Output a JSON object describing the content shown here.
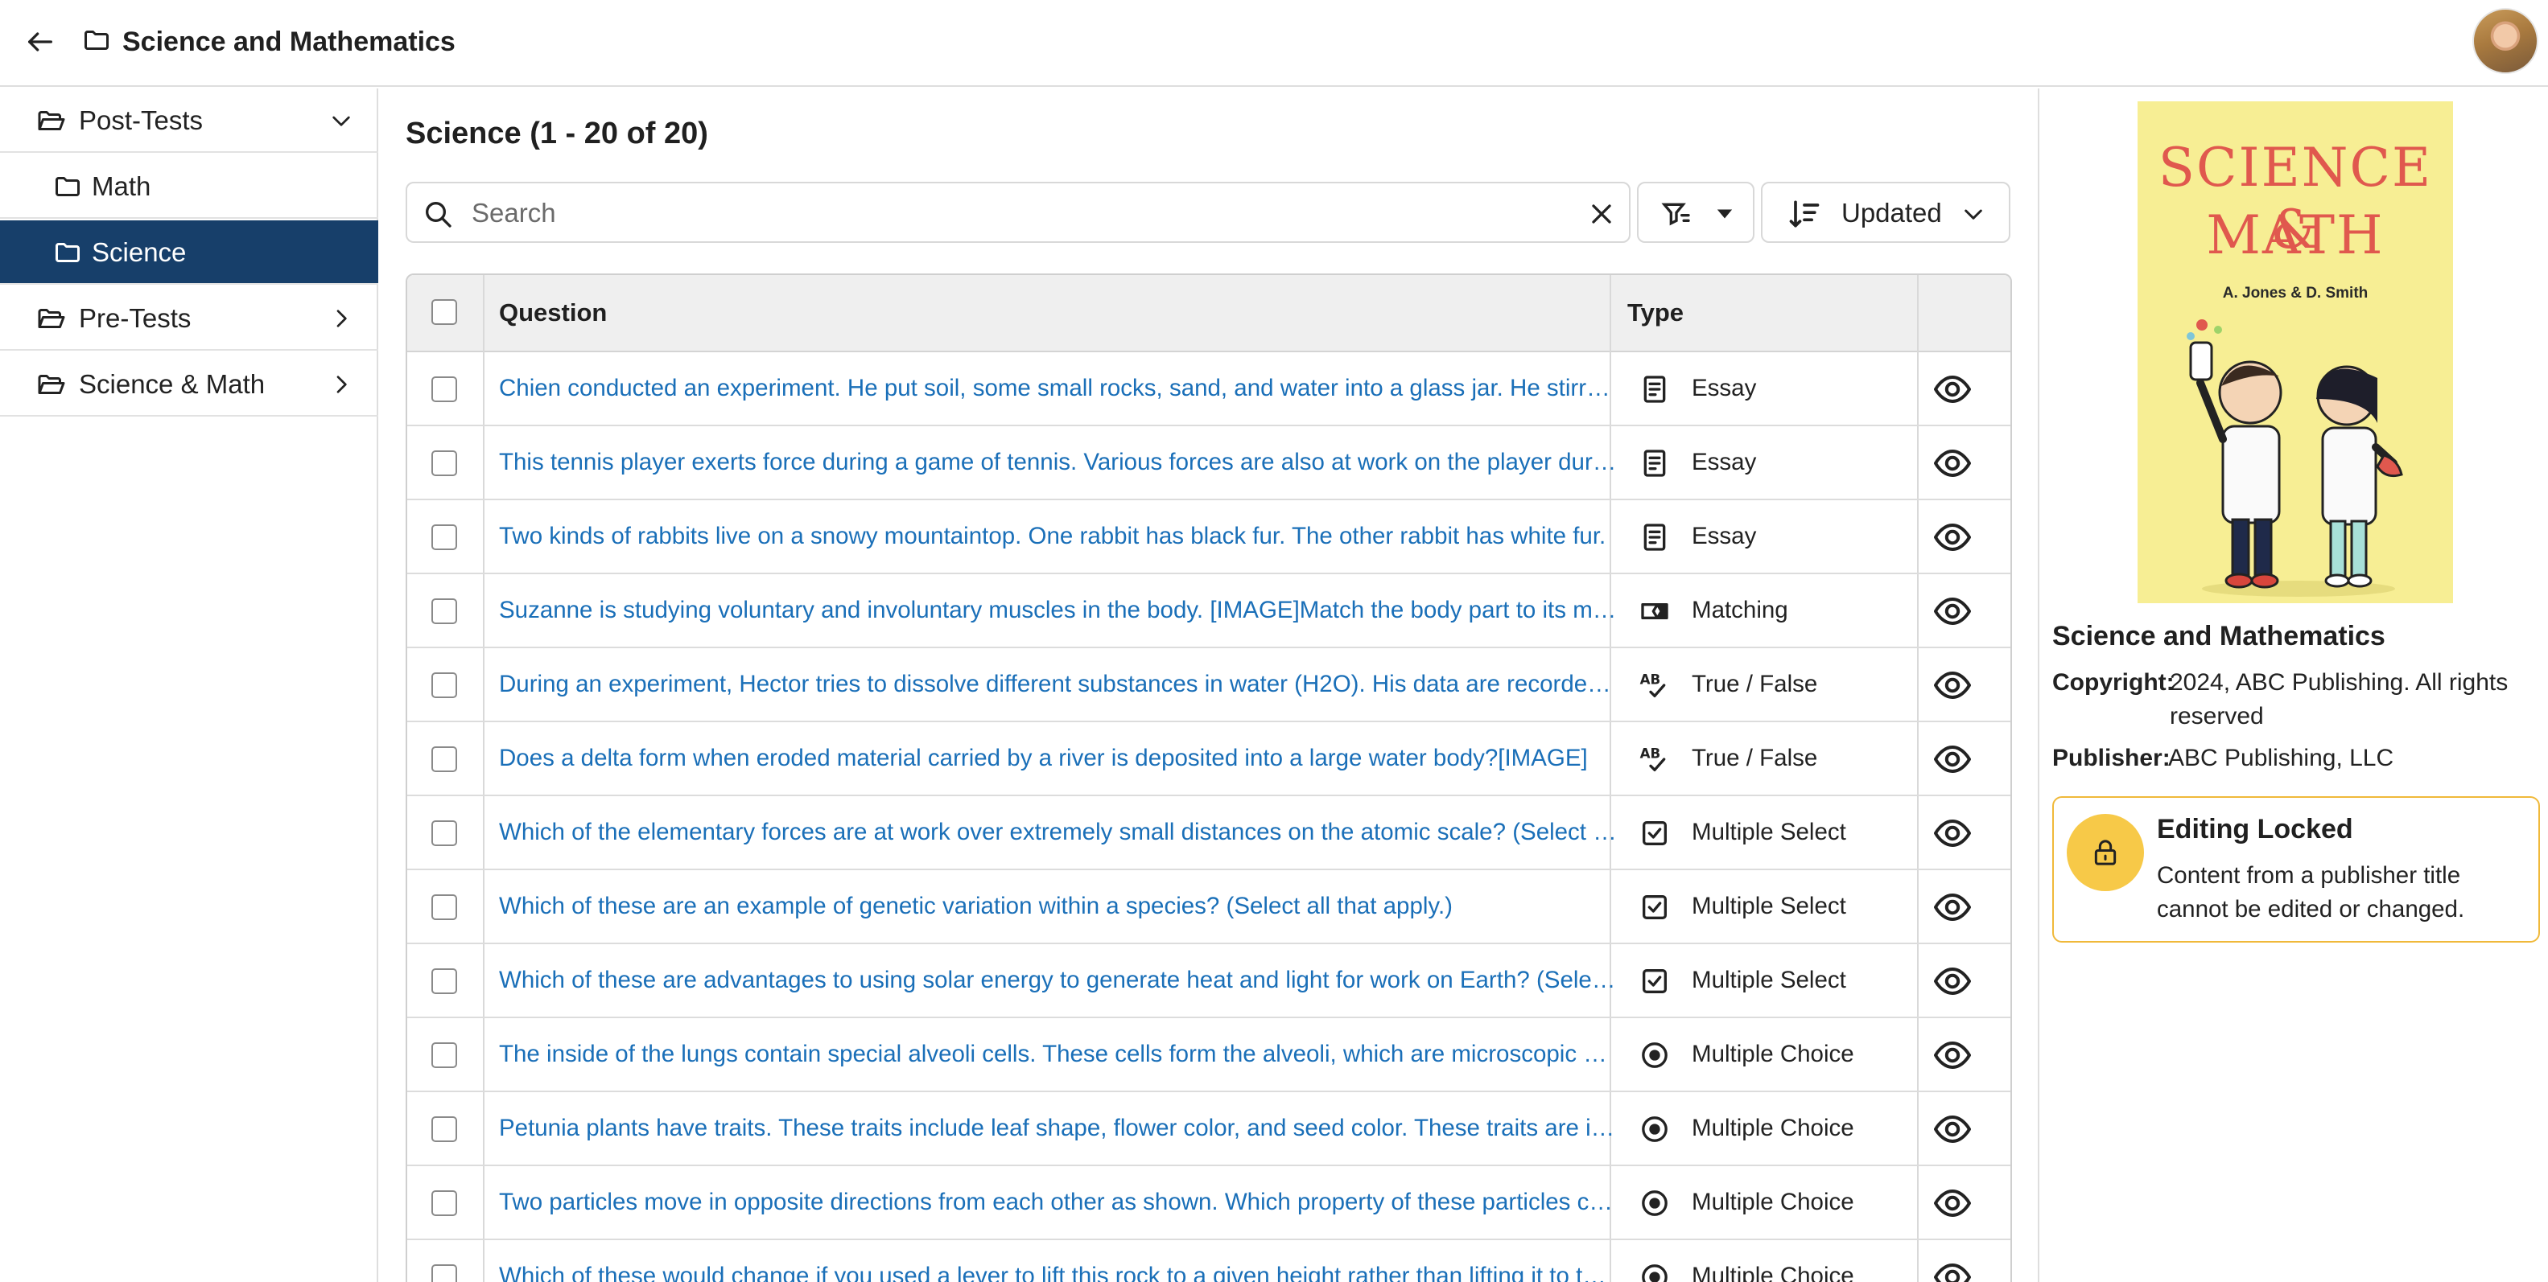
{
  "header": {
    "title": "Science and Mathematics"
  },
  "sidebar": {
    "items": [
      {
        "label": "Post-Tests",
        "chevron": "down",
        "level": 0,
        "active": false
      },
      {
        "label": "Math",
        "chevron": "",
        "level": 1,
        "active": false
      },
      {
        "label": "Science",
        "chevron": "",
        "level": 1,
        "active": true
      },
      {
        "label": "Pre-Tests",
        "chevron": "right",
        "level": 0,
        "active": false
      },
      {
        "label": "Science & Math",
        "chevron": "right",
        "level": 0,
        "active": false
      }
    ]
  },
  "main": {
    "list_title": "Science (1 - 20 of 20)",
    "search_placeholder": "Search",
    "sort_label": "Updated",
    "columns": {
      "question": "Question",
      "type": "Type"
    },
    "rows": [
      {
        "question": "Chien conducted an experiment. He put soil, some small rocks, sand, and water into a glass jar. He stirred the mixture and let it settle.",
        "type": "Essay",
        "icon": "essay-icon"
      },
      {
        "question": "This tennis player exerts force during a game of tennis. Various forces are also at work on the player during the game.",
        "type": "Essay",
        "icon": "essay-icon"
      },
      {
        "question": "Two kinds of rabbits live on a snowy mountaintop. One rabbit has black fur. The other rabbit has white fur.",
        "type": "Essay",
        "icon": "essay-icon"
      },
      {
        "question": "Suzanne is studying voluntary and involuntary muscles in the body. [IMAGE]Match the body part to its muscle type.",
        "type": "Matching",
        "icon": "matching-icon"
      },
      {
        "question": "During an experiment, Hector tries to dissolve different substances in water (H2O). His data are recorded in the table.",
        "type": "True / False",
        "icon": "true-false-icon"
      },
      {
        "question": "Does a delta form when eroded material carried by a river is deposited into a large water body?[IMAGE]",
        "type": "True / False",
        "icon": "true-false-icon"
      },
      {
        "question": "Which of the elementary forces are at work over extremely small distances on the atomic scale? (Select all that apply.)",
        "type": "Multiple Select",
        "icon": "multiple-select-icon"
      },
      {
        "question": "Which of these are an example of genetic variation within a species? (Select all that apply.)",
        "type": "Multiple Select",
        "icon": "multiple-select-icon"
      },
      {
        "question": "Which of these are advantages to using solar energy to generate heat and light for work on Earth? (Select all that apply.)",
        "type": "Multiple Select",
        "icon": "multiple-select-icon"
      },
      {
        "question": "The inside of the lungs contain special alveoli cells. These cells form the alveoli, which are microscopic air sacs.",
        "type": "Multiple Choice",
        "icon": "multiple-choice-icon"
      },
      {
        "question": "Petunia plants have traits. These traits include leaf shape, flower color, and seed color. These traits are inherited.",
        "type": "Multiple Choice",
        "icon": "multiple-choice-icon"
      },
      {
        "question": "Two particles move in opposite directions from each other as shown. Which property of these particles changes?",
        "type": "Multiple Choice",
        "icon": "multiple-choice-icon"
      },
      {
        "question": "Which of these would change if you used a lever to lift this rock to a given height rather than lifting it to the same height?",
        "type": "Multiple Choice",
        "icon": "multiple-choice-icon"
      }
    ]
  },
  "details": {
    "cover_title_line1": "SCIENCE &",
    "cover_title_line2": "MATH",
    "cover_authors": "A. Jones & D. Smith",
    "title": "Science and Mathematics",
    "copyright_label": "Copyright:",
    "copyright_value": "2024, ABC Publishing. All rights reserved",
    "publisher_label": "Publisher:",
    "publisher_value": "ABC Publishing, LLC",
    "lock_title": "Editing Locked",
    "lock_text": "Content from a publisher title cannot be edited or changed."
  },
  "colors": {
    "accent": "#173f6a",
    "link": "#1a6fb8",
    "lock_border": "#f0b93a",
    "lock_fill": "#f7c948",
    "cover_bg": "#f7ee94",
    "cover_title": "#e0584e"
  }
}
